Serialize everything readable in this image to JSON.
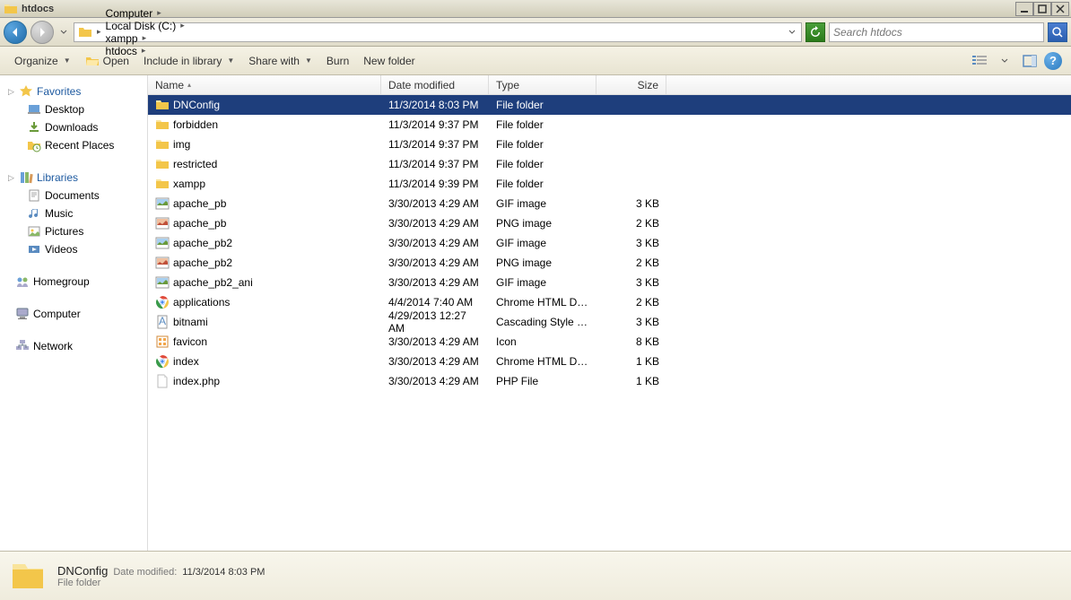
{
  "window": {
    "title": "htdocs"
  },
  "breadcrumb": [
    {
      "label": "Computer"
    },
    {
      "label": "Local Disk (C:)"
    },
    {
      "label": "xampp"
    },
    {
      "label": "htdocs"
    }
  ],
  "search": {
    "placeholder": "Search htdocs"
  },
  "toolbar": {
    "organize": "Organize",
    "open": "Open",
    "include": "Include in library",
    "share": "Share with",
    "burn": "Burn",
    "newfolder": "New folder"
  },
  "sidebar": {
    "favorites": {
      "label": "Favorites",
      "items": [
        "Desktop",
        "Downloads",
        "Recent Places"
      ]
    },
    "libraries": {
      "label": "Libraries",
      "items": [
        "Documents",
        "Music",
        "Pictures",
        "Videos"
      ]
    },
    "homegroup": {
      "label": "Homegroup"
    },
    "computer": {
      "label": "Computer"
    },
    "network": {
      "label": "Network"
    }
  },
  "columns": {
    "name": "Name",
    "date": "Date modified",
    "type": "Type",
    "size": "Size"
  },
  "files": [
    {
      "name": "DNConfig",
      "date": "11/3/2014 8:03 PM",
      "type": "File folder",
      "size": "",
      "icon": "folder",
      "selected": true
    },
    {
      "name": "forbidden",
      "date": "11/3/2014 9:37 PM",
      "type": "File folder",
      "size": "",
      "icon": "folder"
    },
    {
      "name": "img",
      "date": "11/3/2014 9:37 PM",
      "type": "File folder",
      "size": "",
      "icon": "folder"
    },
    {
      "name": "restricted",
      "date": "11/3/2014 9:37 PM",
      "type": "File folder",
      "size": "",
      "icon": "folder"
    },
    {
      "name": "xampp",
      "date": "11/3/2014 9:39 PM",
      "type": "File folder",
      "size": "",
      "icon": "folder"
    },
    {
      "name": "apache_pb",
      "date": "3/30/2013 4:29 AM",
      "type": "GIF image",
      "size": "3 KB",
      "icon": "gif"
    },
    {
      "name": "apache_pb",
      "date": "3/30/2013 4:29 AM",
      "type": "PNG image",
      "size": "2 KB",
      "icon": "png"
    },
    {
      "name": "apache_pb2",
      "date": "3/30/2013 4:29 AM",
      "type": "GIF image",
      "size": "3 KB",
      "icon": "gif"
    },
    {
      "name": "apache_pb2",
      "date": "3/30/2013 4:29 AM",
      "type": "PNG image",
      "size": "2 KB",
      "icon": "png"
    },
    {
      "name": "apache_pb2_ani",
      "date": "3/30/2013 4:29 AM",
      "type": "GIF image",
      "size": "3 KB",
      "icon": "gif"
    },
    {
      "name": "applications",
      "date": "4/4/2014 7:40 AM",
      "type": "Chrome HTML Docu...",
      "size": "2 KB",
      "icon": "chrome"
    },
    {
      "name": "bitnami",
      "date": "4/29/2013 12:27 AM",
      "type": "Cascading Style Sh...",
      "size": "3 KB",
      "icon": "css"
    },
    {
      "name": "favicon",
      "date": "3/30/2013 4:29 AM",
      "type": "Icon",
      "size": "8 KB",
      "icon": "ico"
    },
    {
      "name": "index",
      "date": "3/30/2013 4:29 AM",
      "type": "Chrome HTML Docu...",
      "size": "1 KB",
      "icon": "chrome"
    },
    {
      "name": "index.php",
      "date": "3/30/2013 4:29 AM",
      "type": "PHP File",
      "size": "1 KB",
      "icon": "file"
    }
  ],
  "details": {
    "name": "DNConfig",
    "modified_label": "Date modified:",
    "modified_value": "11/3/2014 8:03 PM",
    "type": "File folder"
  }
}
